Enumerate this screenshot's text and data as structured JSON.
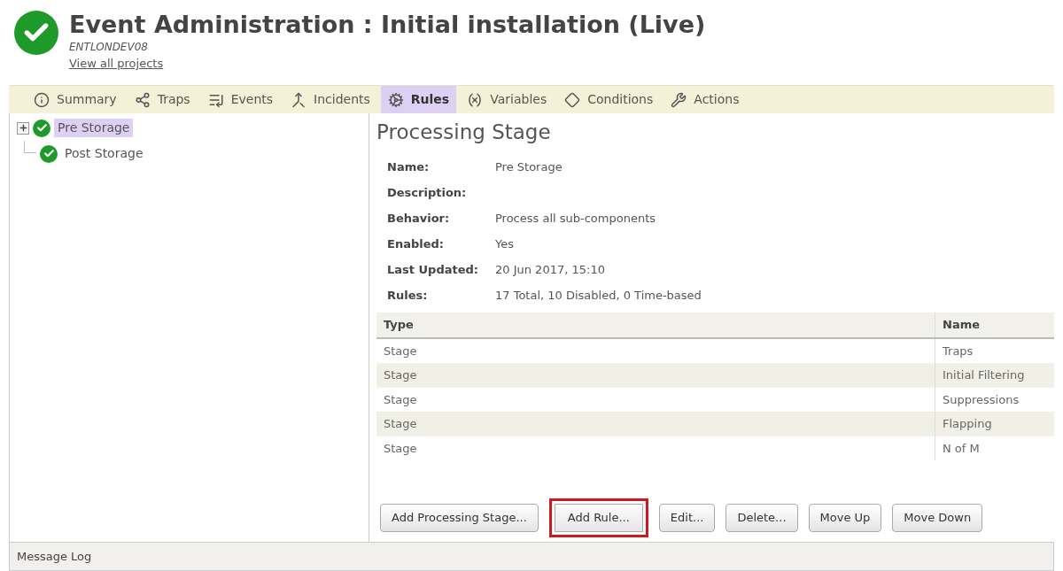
{
  "header": {
    "title": "Event Administration : Initial installation (Live)",
    "server": "ENTLONDEV08",
    "link": "View all projects"
  },
  "tabs": [
    {
      "label": "Summary",
      "kind": "info",
      "selected": false
    },
    {
      "label": "Traps",
      "kind": "traps",
      "selected": false
    },
    {
      "label": "Events",
      "kind": "events",
      "selected": false
    },
    {
      "label": "Incidents",
      "kind": "incidents",
      "selected": false
    },
    {
      "label": "Rules",
      "kind": "rules",
      "selected": true
    },
    {
      "label": "Variables",
      "kind": "variables",
      "selected": false
    },
    {
      "label": "Conditions",
      "kind": "conditions",
      "selected": false
    },
    {
      "label": "Actions",
      "kind": "actions",
      "selected": false
    }
  ],
  "tree": [
    {
      "label": "Pre Storage",
      "selected": true,
      "expandable": true
    },
    {
      "label": "Post Storage",
      "selected": false,
      "expandable": false
    }
  ],
  "detail": {
    "title": "Processing Stage",
    "fields": [
      {
        "label": "Name:",
        "value": "Pre Storage"
      },
      {
        "label": "Description:"
      },
      {
        "label": "Behavior:",
        "value": "Process all sub-components"
      },
      {
        "label": "Enabled:",
        "value": "Yes"
      },
      {
        "label": "Last Updated:",
        "value": "20 Jun 2017, 15:10"
      },
      {
        "label": "Rules:",
        "value": "17 Total, 10 Disabled, 0 Time-based"
      }
    ]
  },
  "table": {
    "columns": [
      "Type",
      "Name"
    ],
    "rows": [
      [
        "Stage",
        "Traps"
      ],
      [
        "Stage",
        "Initial Filtering"
      ],
      [
        "Stage",
        "Suppressions"
      ],
      [
        "Stage",
        "Flapping"
      ],
      [
        "Stage",
        "N of M"
      ]
    ]
  },
  "buttons": [
    {
      "label": "Add Processing Stage...",
      "highlighted": false
    },
    {
      "label": "Add Rule...",
      "highlighted": true
    },
    {
      "label": "Edit...",
      "highlighted": false
    },
    {
      "label": "Delete...",
      "highlighted": false
    },
    {
      "label": "Move Up",
      "highlighted": false
    },
    {
      "label": "Move Down",
      "highlighted": false
    }
  ],
  "status_bar": "Message Log"
}
